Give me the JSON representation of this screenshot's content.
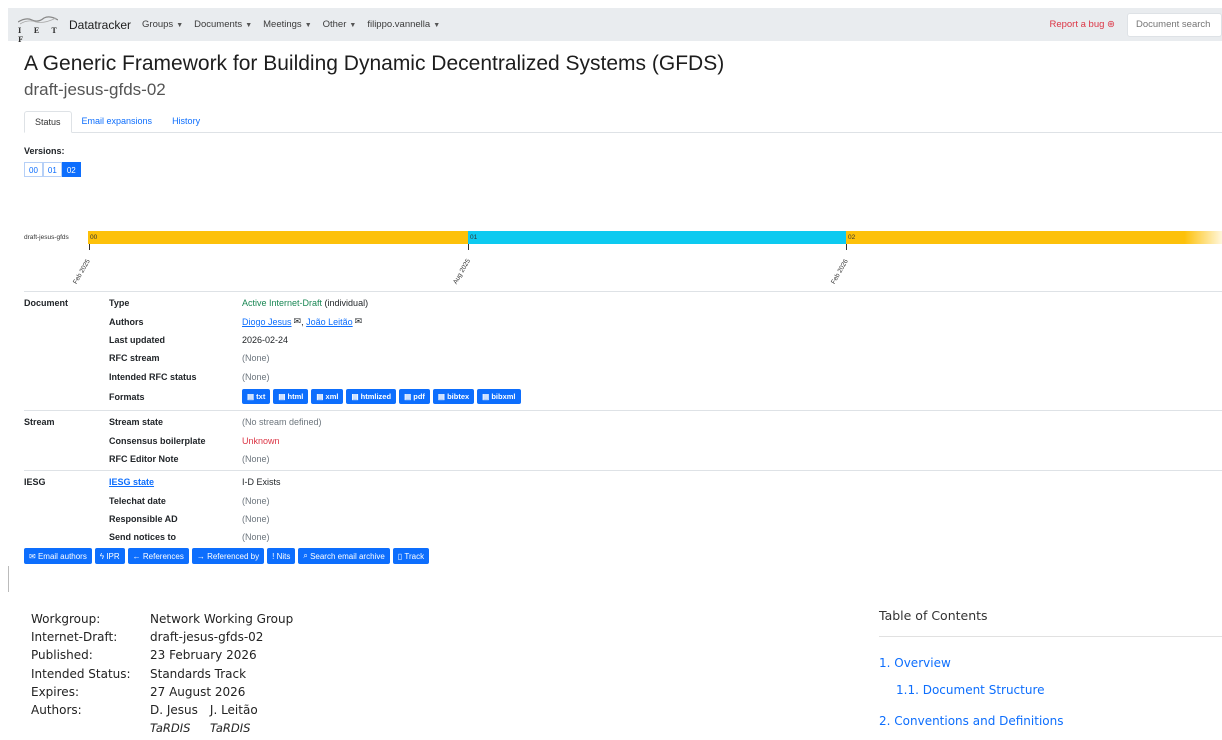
{
  "navbar": {
    "logo_text": "I E T F",
    "brand": "Datatracker",
    "items": [
      {
        "label": "Groups"
      },
      {
        "label": "Documents"
      },
      {
        "label": "Meetings"
      },
      {
        "label": "Other"
      },
      {
        "label": "filippo.vannella"
      }
    ],
    "report_bug": "Report a bug",
    "search_placeholder": "Document search"
  },
  "page": {
    "title": "A Generic Framework for Building Dynamic Decentralized Systems (GFDS)",
    "subtitle": "draft-jesus-gfds-02"
  },
  "tabs": [
    {
      "label": "Status"
    },
    {
      "label": "Email expansions"
    },
    {
      "label": "History"
    }
  ],
  "versions": {
    "label": "Versions:",
    "items": [
      "00",
      "01",
      "02"
    ],
    "active": "02"
  },
  "timeline": {
    "doc": "draft-jesus-gfds",
    "segments": [
      "00",
      "01",
      "02"
    ],
    "dates": [
      "Feb 2025",
      "Aug 2025",
      "Feb 2026"
    ],
    "colors": {
      "odd": "#fdc10a",
      "even": "#0dcaf0"
    }
  },
  "info": {
    "document": {
      "section": "Document",
      "type_label": "Type",
      "type_value": "Active Internet-Draft",
      "type_suffix": "(individual)",
      "authors_label": "Authors",
      "author1": "Diogo Jesus",
      "author2": "João Leitão",
      "author_sep": ",",
      "updated_label": "Last updated",
      "updated_value": "2026-02-24",
      "rfcstream_label": "RFC stream",
      "rfcstream_value": "(None)",
      "intended_label": "Intended RFC status",
      "intended_value": "(None)",
      "formats_label": "Formats",
      "formats": [
        "txt",
        "html",
        "xml",
        "htmlized",
        "pdf",
        "bibtex",
        "bibxml"
      ]
    },
    "stream": {
      "section": "Stream",
      "state_label": "Stream state",
      "state_value": "(No stream defined)",
      "consensus_label": "Consensus boilerplate",
      "consensus_value": "Unknown",
      "note_label": "RFC Editor Note",
      "note_value": "(None)"
    },
    "iesg": {
      "section": "IESG",
      "state_label": "IESG state",
      "state_value": "I-D Exists",
      "telechat_label": "Telechat date",
      "telechat_value": "(None)",
      "ad_label": "Responsible AD",
      "ad_value": "(None)",
      "notices_label": "Send notices to",
      "notices_value": "(None)"
    }
  },
  "actions": [
    "Email authors",
    "IPR",
    "References",
    "Referenced by",
    "Nits",
    "Search email archive",
    "Track"
  ],
  "docmeta": {
    "workgroup_label": "Workgroup:",
    "workgroup_value": "Network Working Group",
    "id_label": "Internet-Draft:",
    "id_value": "draft-jesus-gfds-02",
    "published_label": "Published:",
    "published_value": "23 February 2026",
    "status_label": "Intended Status:",
    "status_value": "Standards Track",
    "expires_label": "Expires:",
    "expires_value": "27 August 2026",
    "authors_label": "Authors:",
    "author1_name": "D. Jesus",
    "author1_org": "TaRDIS",
    "author2_name": "J. Leitão",
    "author2_org": "TaRDIS"
  },
  "toc": {
    "title": "Table of Contents",
    "items": [
      "1. Overview",
      "1.1. Document Structure",
      "2. Conventions and Definitions"
    ]
  }
}
